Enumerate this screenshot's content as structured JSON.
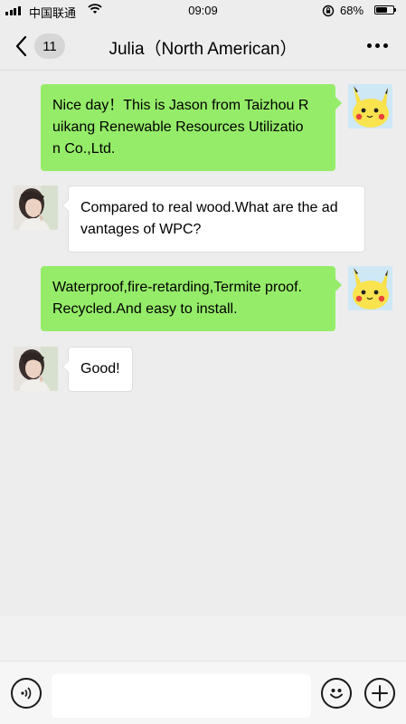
{
  "status_bar": {
    "carrier": "中国联通",
    "time": "09:09",
    "battery_percent": "68%",
    "battery_level": 0.68,
    "icons": [
      "signal-icon",
      "wifi-icon",
      "orientation-lock-icon",
      "battery-icon"
    ]
  },
  "nav": {
    "unread_count": "11",
    "title": "Julia（North American）",
    "icons": [
      "back-chevron-icon",
      "more-dots-icon"
    ]
  },
  "messages": [
    {
      "direction": "out",
      "sender": "Jason",
      "lines": [
        "Nice day！This is Jason from Taizhou R",
        "uikang Renewable Resources Utilizatio",
        "n Co.,Ltd."
      ]
    },
    {
      "direction": "in",
      "sender": "Julia",
      "lines": [
        "Compared to real wood.What are the ad",
        "vantages of WPC?"
      ]
    },
    {
      "direction": "out",
      "sender": "Jason",
      "lines": [
        "Waterproof,fire-retarding,Termite proof.",
        "Recycled.And easy to install."
      ]
    },
    {
      "direction": "in",
      "sender": "Julia",
      "lines": [
        "Good!"
      ]
    }
  ],
  "input_bar": {
    "placeholder": "",
    "icons": [
      "voice-icon",
      "emoji-icon",
      "plus-icon"
    ]
  },
  "colors": {
    "background": "#ededed",
    "outgoing_bubble": "#95ec69",
    "incoming_bubble": "#ffffff"
  }
}
